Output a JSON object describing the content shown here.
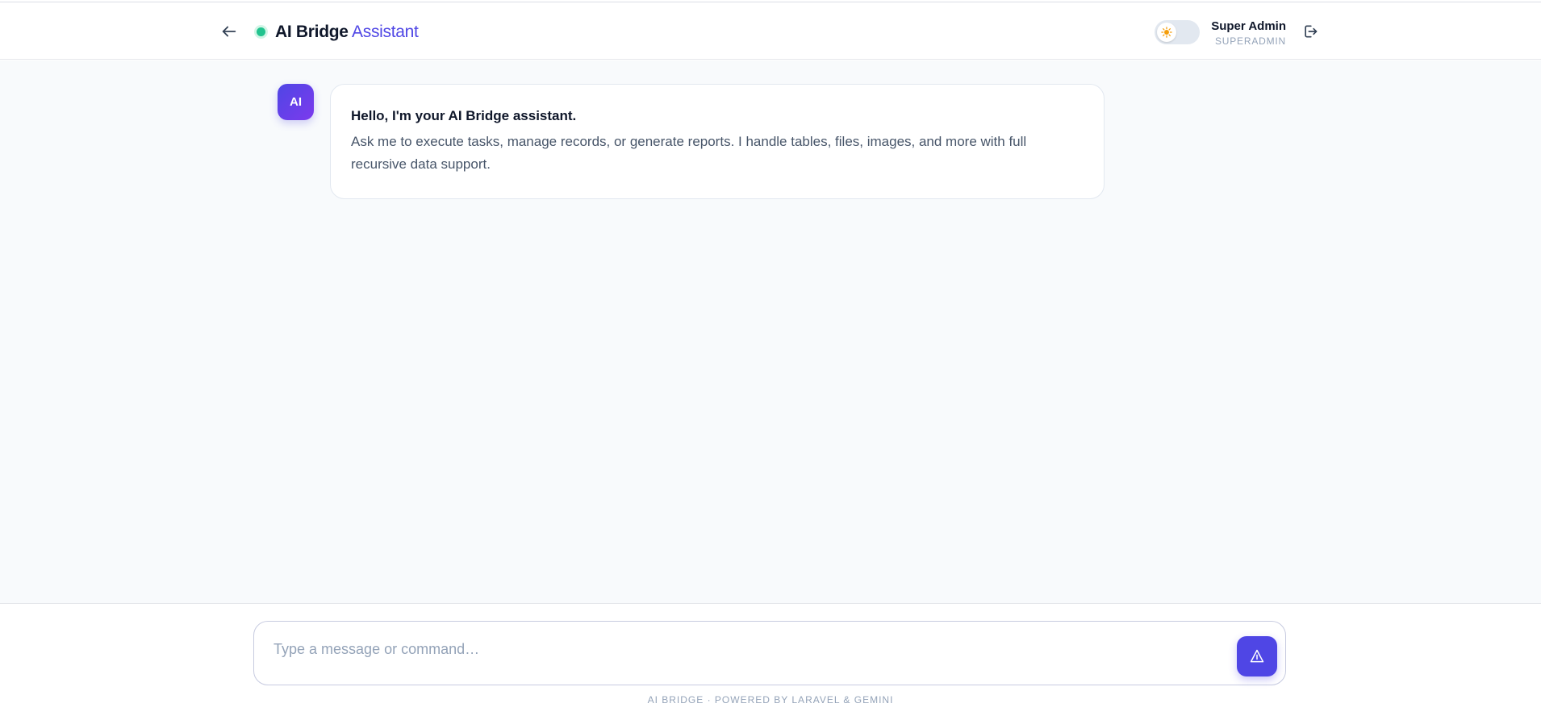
{
  "header": {
    "title_strong": "AI Bridge",
    "title_accent": "Assistant",
    "user_name": "Super Admin",
    "user_role": "SUPERADMIN"
  },
  "icons": {
    "back": "arrow-left-icon",
    "status": "online-status-dot",
    "theme": "sun-icon",
    "logout": "logout-icon",
    "send": "send-icon"
  },
  "colors": {
    "accent": "#4f46e5",
    "status_online": "#22c38e",
    "sun": "#f59e0b"
  },
  "chat": {
    "messages": [
      {
        "sender": "AI",
        "heading": "Hello, I'm your AI Bridge assistant.",
        "body": "Ask me to execute tasks, manage records, or generate reports. I handle tables, files, images, and more with full recursive data support."
      }
    ]
  },
  "composer": {
    "placeholder": "Type a message or command…",
    "value": ""
  },
  "footer": {
    "note": "AI BRIDGE · POWERED BY LARAVEL & GEMINI"
  }
}
